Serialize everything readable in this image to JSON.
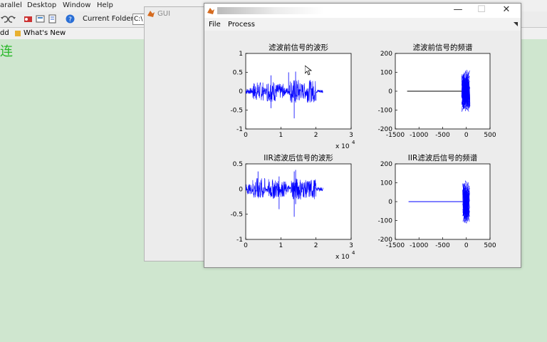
{
  "desktop": {
    "menu": [
      "arallel",
      "Desktop",
      "Window",
      "Help"
    ],
    "current_folder_label": "Current Folder:",
    "current_folder_value": "C:\\",
    "shortcuts": [
      "dd",
      "What's New"
    ],
    "green_text": "连"
  },
  "gui_window": {
    "title": "GUI"
  },
  "figure": {
    "menu": [
      "File",
      "Process"
    ],
    "controls": {
      "minimize": "—",
      "maximize": "☐",
      "close": "✕"
    }
  },
  "colors": {
    "signal": "#0000ff",
    "desktop_bg": "#cfe6cf",
    "green_text": "#28b828"
  },
  "chart_data": [
    {
      "type": "line",
      "title": "滤波前信号的波形",
      "xlim": [
        0,
        3
      ],
      "ylim": [
        -1,
        1
      ],
      "xticks": [
        "0",
        "1",
        "2",
        "3"
      ],
      "yticks": [
        "-1",
        "-0.5",
        "0",
        "0.5",
        "1"
      ],
      "xscale_label": "x 10",
      "xscale_exp": "4",
      "segments": [
        {
          "x0": 0.0,
          "x1": 0.2,
          "amp": 0.08
        },
        {
          "x0": 0.2,
          "x1": 0.5,
          "amp": 0.25
        },
        {
          "x0": 0.5,
          "x1": 0.6,
          "amp": 0.1
        },
        {
          "x0": 0.6,
          "x1": 0.85,
          "amp": 0.28
        },
        {
          "x0": 0.85,
          "x1": 1.1,
          "amp": 0.2
        },
        {
          "x0": 1.1,
          "x1": 1.25,
          "amp": 0.1
        },
        {
          "x0": 1.25,
          "x1": 1.55,
          "amp": 0.32
        },
        {
          "x0": 1.55,
          "x1": 1.75,
          "amp": 0.22
        },
        {
          "x0": 1.75,
          "x1": 2.0,
          "amp": 0.3
        },
        {
          "x0": 2.0,
          "x1": 2.2,
          "amp": 0.05
        }
      ],
      "spikes": [
        {
          "x": 1.22,
          "y0": -0.05,
          "y1": 0.5
        },
        {
          "x": 1.38,
          "y0": -0.72,
          "y1": 0.15
        },
        {
          "x": 1.42,
          "y0": -0.3,
          "y1": 0.52
        },
        {
          "x": 0.72,
          "y0": -0.45,
          "y1": 0.42
        }
      ]
    },
    {
      "type": "line",
      "title": "滤波前信号的频谱",
      "xlim": [
        -1500,
        500
      ],
      "ylim": [
        -200,
        200
      ],
      "xticks": [
        "-1500",
        "-1000",
        "-500",
        "0",
        "500"
      ],
      "yticks": [
        "-200",
        "-100",
        "0",
        "100",
        "200"
      ],
      "flat_line": {
        "x0": -1250,
        "x1": -100,
        "y": 0
      },
      "noise": {
        "x0": -100,
        "x1": 80,
        "amp": 120
      }
    },
    {
      "type": "line",
      "title": "IIR滤波后信号的波形",
      "xlim": [
        0,
        3
      ],
      "ylim": [
        -1,
        0.5
      ],
      "xticks": [
        "0",
        "1",
        "2",
        "3"
      ],
      "yticks": [
        "-1",
        "-0.5",
        "0",
        "0.5"
      ],
      "xscale_label": "x 10",
      "xscale_exp": "4",
      "segments": [
        {
          "x0": 0.0,
          "x1": 0.2,
          "amp": 0.1
        },
        {
          "x0": 0.2,
          "x1": 0.55,
          "amp": 0.22
        },
        {
          "x0": 0.55,
          "x1": 0.65,
          "amp": 0.08
        },
        {
          "x0": 0.65,
          "x1": 0.9,
          "amp": 0.2
        },
        {
          "x0": 0.9,
          "x1": 1.15,
          "amp": 0.16
        },
        {
          "x0": 1.15,
          "x1": 1.3,
          "amp": 0.08
        },
        {
          "x0": 1.3,
          "x1": 1.6,
          "amp": 0.22
        },
        {
          "x0": 1.6,
          "x1": 1.8,
          "amp": 0.18
        },
        {
          "x0": 1.8,
          "x1": 2.0,
          "amp": 0.2
        },
        {
          "x0": 2.0,
          "x1": 2.2,
          "amp": 0.04
        }
      ],
      "spikes": [
        {
          "x": 0.95,
          "y0": -0.4,
          "y1": 0.25
        },
        {
          "x": 1.38,
          "y0": -0.55,
          "y1": 0.35
        },
        {
          "x": 1.42,
          "y0": -0.3,
          "y1": 0.38
        },
        {
          "x": 0.35,
          "y0": -0.15,
          "y1": 0.35
        }
      ]
    },
    {
      "type": "line",
      "title": "IIR滤波后信号的频谱",
      "xlim": [
        -1500,
        500
      ],
      "ylim": [
        -200,
        200
      ],
      "xticks": [
        "-1500",
        "-1000",
        "-500",
        "0",
        "500"
      ],
      "yticks": [
        "-200",
        "-100",
        "0",
        "100",
        "200"
      ],
      "flat_line": {
        "x0": -1220,
        "x1": -80,
        "y": 0
      },
      "noise": {
        "x0": -80,
        "x1": 70,
        "amp": 120
      }
    }
  ]
}
